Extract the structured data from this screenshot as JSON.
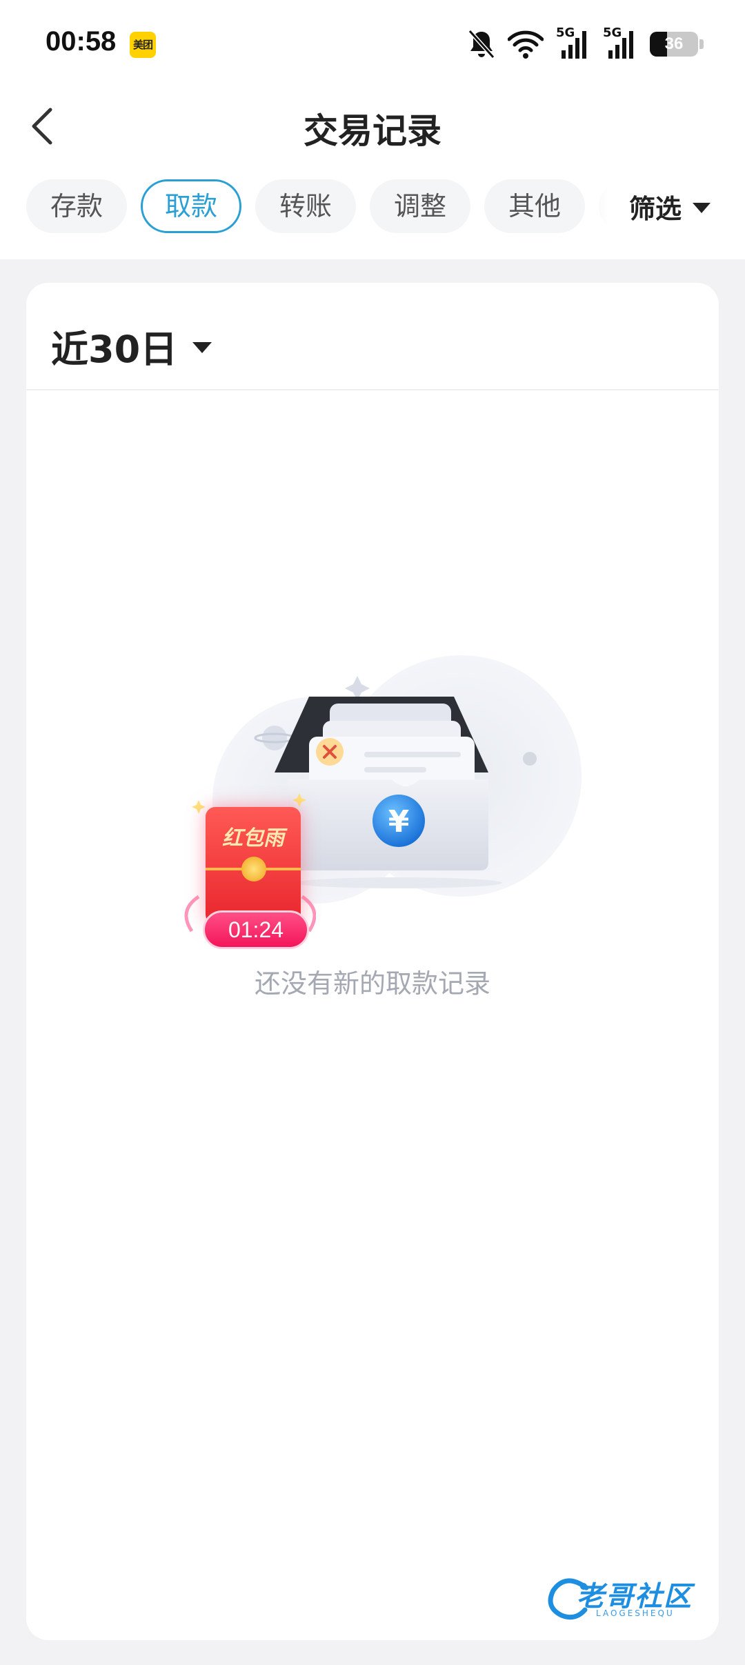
{
  "status_bar": {
    "time": "00:58",
    "app_badge": "美团",
    "signal_1": "5G",
    "signal_2": "5G",
    "battery_level": "36",
    "battery_fraction": 0.36,
    "icons": [
      "bell-muted-icon",
      "wifi-icon",
      "signal-5g-icon",
      "signal-5g-icon",
      "battery-icon"
    ]
  },
  "nav": {
    "title": "交易记录",
    "back_icon": "chevron-left-icon"
  },
  "tabs": [
    {
      "label": "存款",
      "active": false
    },
    {
      "label": "取款",
      "active": true
    },
    {
      "label": "转账",
      "active": false
    },
    {
      "label": "调整",
      "active": false
    },
    {
      "label": "其他",
      "active": false
    }
  ],
  "filter": {
    "label": "筛选",
    "icon": "caret-down-icon"
  },
  "period": {
    "label": "近30日",
    "icon": "caret-down-icon"
  },
  "empty_state": {
    "message": "还没有新的取款记录",
    "illustration": "empty-drawer-yuan-icon"
  },
  "red_packet": {
    "title": "红包雨",
    "countdown": "01:24"
  },
  "watermark": {
    "text": "老哥社区",
    "sub": "LAOGESHEQU"
  },
  "colors": {
    "accent": "#2a9fd4",
    "background": "#f2f2f5",
    "card": "#ffffff",
    "muted_text": "#a4a8b2",
    "red_packet": "#e8262d"
  }
}
